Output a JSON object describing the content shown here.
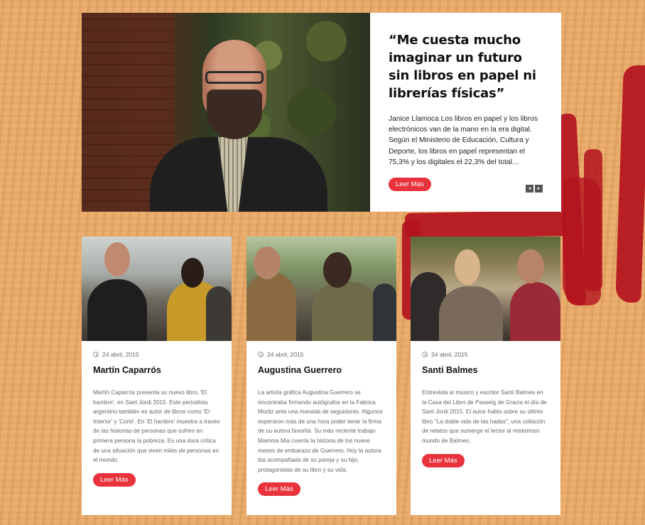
{
  "hero": {
    "title": "“Me cuesta mucho imaginar un futuro sin libros en papel ni librerías físicas”",
    "body": "Janice Llamoca Los libros en papel y los libros electrónicos van de la mano en la era digital. Según el Ministerio de Educación, Cultura y Deporte, los libros en papel representan el 75,3% y los digitales el 22,3% del total…",
    "button": "Leer Más",
    "prev_icon": "◂",
    "next_icon": "▸"
  },
  "cards": [
    {
      "date": "24 abril, 2015",
      "title": "Martín Caparrós",
      "body": "Martín Caparrós presenta su nuevo libro, 'El hambre', en Sant Jordi 2015. Este periodista argentino también es autor de libros como 'El Interior' y 'Comi'. En 'El hambre' muestra a través de las historias de personas que sufren en primera persona la pobreza. Es una dura crítica de una situación que viven miles de personas en el mundo.",
      "button": "Leer Más"
    },
    {
      "date": "24 abril, 2015",
      "title": "Augustina Guerrero",
      "body": "La artista gráfica Augustina Guerrero se encontraba firmando autógrafos en la Fabrica Moritz ante una manada de seguidores. Algunos esperaron más de una hora poder tener la firma de su autora favorita. Su más reciente trabajo Mamma Mia cuenta la historia de los nueve meses de embarazo de Guerrero. Hoy la autora iba acompañada de su pareja y su hijo, protagonistas de su libro y su vida.",
      "button": "Leer Más"
    },
    {
      "date": "24 abril, 2015",
      "title": "Santi Balmes",
      "body": "Entrevista al músico y escritor Santi Balmes en la Casa del Libro de Passeig de Gracia el día de Sant Jordi 2015. El autor habla sobre su último libro \"La doble vida de las hadas\", una collación de relatos que sumerge el lector al misterioso mundo de Balmes.",
      "button": "Leer Más"
    }
  ],
  "colors": {
    "accent": "#e8333d",
    "background": "#e9a864",
    "brush": "#b3141e"
  }
}
